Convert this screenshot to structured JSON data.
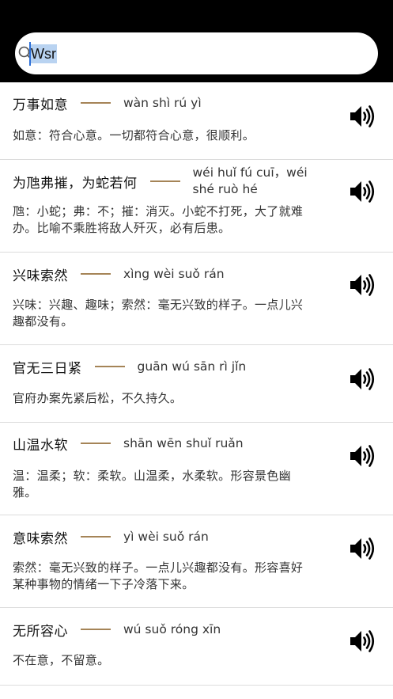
{
  "search": {
    "value": "Wsr"
  },
  "entries": [
    {
      "word": "万事如意",
      "pinyin": "wàn shì rú yì",
      "definition": "如意：符合心意。一切都符合心意，很顺利。"
    },
    {
      "word": "为虺弗摧，为蛇若何",
      "pinyin": "wéi huǐ fú cuī，wéi shé ruò hé",
      "definition": "虺：小蛇；弗：不；摧：消灭。小蛇不打死，大了就难办。比喻不乘胜将敌人歼灭，必有后患。"
    },
    {
      "word": "兴味索然",
      "pinyin": "xìng wèi suǒ rán",
      "definition": "兴味：兴趣、趣味；索然：毫无兴致的样子。一点儿兴趣都没有。"
    },
    {
      "word": "官无三日紧",
      "pinyin": "guān wú sān rì jǐn",
      "definition": "官府办案先紧后松，不久持久。"
    },
    {
      "word": "山温水软",
      "pinyin": "shān wēn shuǐ ruǎn",
      "definition": "温：温柔；软：柔软。山温柔，水柔软。形容景色幽雅。"
    },
    {
      "word": "意味索然",
      "pinyin": "yì wèi suǒ rán",
      "definition": "索然：毫无兴致的样子。一点儿兴趣都没有。形容喜好某种事物的情绪一下子冷落下来。"
    },
    {
      "word": "无所容心",
      "pinyin": "wú suǒ róng xīn",
      "definition": "不在意，不留意。"
    }
  ]
}
